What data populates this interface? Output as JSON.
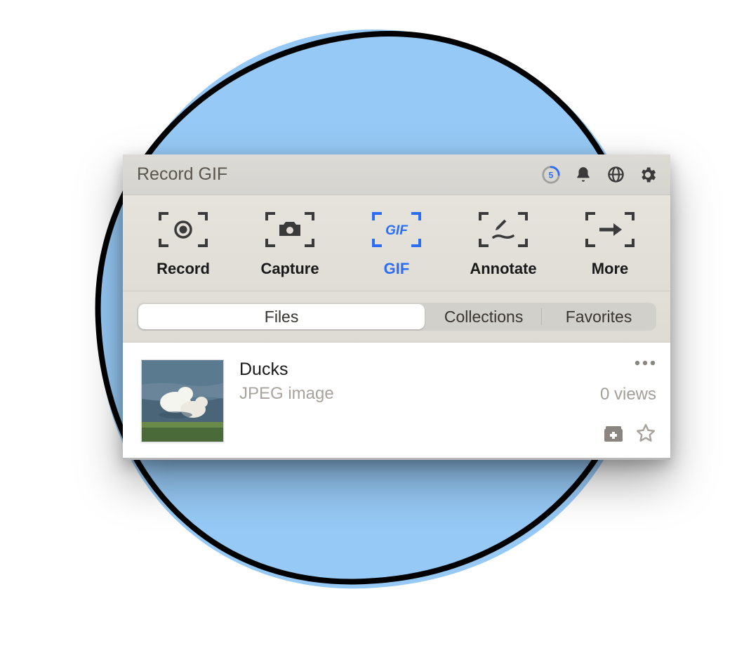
{
  "header": {
    "title": "Record GIF",
    "countdown": "5"
  },
  "toolbar": {
    "items": [
      {
        "label": "Record",
        "active": false
      },
      {
        "label": "Capture",
        "active": false
      },
      {
        "label": "GIF",
        "active": true
      },
      {
        "label": "Annotate",
        "active": false
      },
      {
        "label": "More",
        "active": false
      }
    ],
    "gif_text": "GIF"
  },
  "tabs": {
    "items": [
      "Files",
      "Collections",
      "Favorites"
    ],
    "active_index": 0
  },
  "file_row": {
    "name": "Ducks",
    "type": "JPEG image",
    "views": "0 views"
  },
  "colors": {
    "accent": "#2b6df6",
    "icon_dark": "#3a3a3a"
  }
}
